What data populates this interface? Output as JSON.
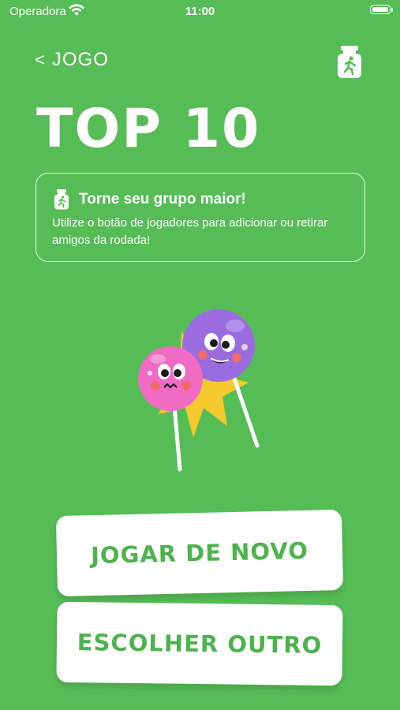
{
  "status_bar": {
    "carrier": "Operadora",
    "time": "11:00"
  },
  "header": {
    "back_label": "JOGO",
    "back_chevron": "<",
    "players_icon": "players-jar-icon"
  },
  "title": "TOP 10",
  "tip": {
    "icon": "players-jar-icon",
    "title": "Torne seu grupo maior!",
    "body": "Utilize o botão de jogadores para adicionar ou retirar amigos da rodada!"
  },
  "illustration": "lollipop-mascots-icon",
  "actions": {
    "play_again": "JOGAR DE NOVO",
    "choose_other": "ESCOLHER OUTRO"
  },
  "colors": {
    "background": "#56BD56",
    "button_text": "#4DB34D",
    "pink": "#F06BC4",
    "purple": "#9B6BE0",
    "star": "#F6C92E"
  }
}
